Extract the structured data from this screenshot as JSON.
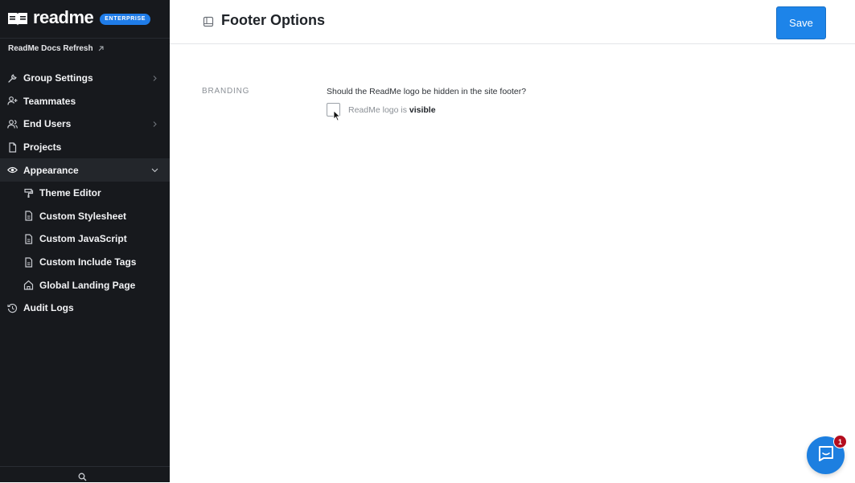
{
  "brand": {
    "name": "readme",
    "badge": "ENTERPRISE"
  },
  "project": {
    "name": "ReadMe Docs Refresh",
    "icon": "external-link-icon"
  },
  "sidebar": {
    "items": [
      {
        "label": "Group Settings",
        "icon": "wrench-icon",
        "chevron": "right"
      },
      {
        "label": "Teammates",
        "icon": "add-user-icon"
      },
      {
        "label": "End Users",
        "icon": "users-icon",
        "chevron": "right"
      },
      {
        "label": "Projects",
        "icon": "document-icon"
      },
      {
        "label": "Appearance",
        "icon": "eye-icon",
        "chevron": "down",
        "active": true
      },
      {
        "label": "Theme Editor",
        "icon": "paint-roller-icon",
        "sub": true
      },
      {
        "label": "Custom Stylesheet",
        "icon": "file-icon",
        "sub": true
      },
      {
        "label": "Custom JavaScript",
        "icon": "file-icon",
        "sub": true
      },
      {
        "label": "Custom Include Tags",
        "icon": "file-icon",
        "sub": true
      },
      {
        "label": "Global Landing Page",
        "icon": "home-icon",
        "sub": true
      },
      {
        "label": "Audit Logs",
        "icon": "history-icon"
      }
    ],
    "bottom_icon": "search-icon"
  },
  "header": {
    "title": "Footer Options",
    "icon": "layout-icon",
    "save_label": "Save"
  },
  "content": {
    "section_label": "BRANDING",
    "question": "Should the ReadMe logo be hidden in the site footer?",
    "checkbox_checked": false,
    "checkbox_label_prefix": "ReadMe logo is ",
    "checkbox_label_state": "visible"
  },
  "chat": {
    "icon": "chat-icon",
    "badge_count": "1"
  },
  "colors": {
    "sidebar_bg": "#17191d",
    "accent": "#1d84e9",
    "badge_red": "#b40d1e"
  }
}
